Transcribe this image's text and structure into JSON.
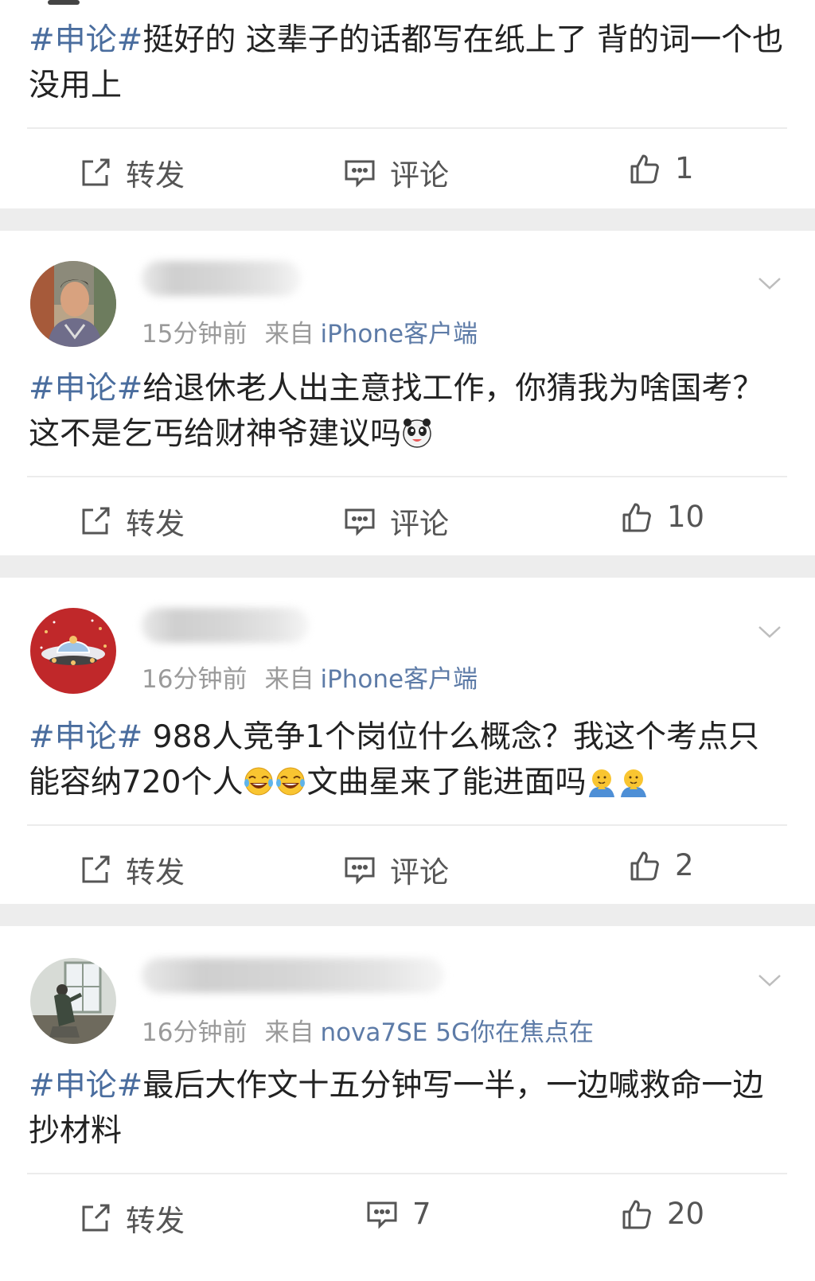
{
  "feed": {
    "posts": [
      {
        "hashtag": "#申论#",
        "text": "挺好的 这辈子的话都写在纸上了 背的词一个也没用上",
        "actions": {
          "repost_label": "转发",
          "comment_label": "评论",
          "like_count": "1"
        }
      },
      {
        "time": "15分钟前",
        "from_label": "来自",
        "source": "iPhone客户端",
        "hashtag": "#申论#",
        "text": "给退休老人出主意找工作，你猜我为啥国考？这不是乞丐给财神爷建议吗",
        "emojis": [
          "panda-face-emoji"
        ],
        "actions": {
          "repost_label": "转发",
          "comment_label": "评论",
          "like_count": "10"
        }
      },
      {
        "time": "16分钟前",
        "from_label": "来自",
        "source": "iPhone客户端",
        "hashtag": "#申论#",
        "text_part1": " 988人竞争1个岗位什么概念？我这个考点只能容纳720个人",
        "text_part2": "文曲星来了能进面吗",
        "emojis": [
          "laugh-cry-emoji",
          "laugh-cry-emoji",
          "pray-emoji",
          "pray-emoji"
        ],
        "actions": {
          "repost_label": "转发",
          "comment_label": "评论",
          "like_count": "2"
        }
      },
      {
        "time": "16分钟前",
        "from_label": "来自",
        "source": "nova7SE 5G你在焦点在",
        "hashtag": "#申论#",
        "text": "最后大作文十五分钟写一半，一边喊救命一边抄材料",
        "actions": {
          "repost_label": "转发",
          "comment_count": "7",
          "like_count": "20"
        }
      }
    ]
  },
  "colors": {
    "hashtag": "#4a6d9e",
    "source": "#5d7ba7",
    "meta": "#9a9a9a",
    "separator": "#ededed",
    "icon": "#555555"
  },
  "icons": {
    "repost": "share-square-icon",
    "comment": "comment-bubble-icon",
    "like": "thumbs-up-icon",
    "menu": "chevron-down-icon"
  }
}
